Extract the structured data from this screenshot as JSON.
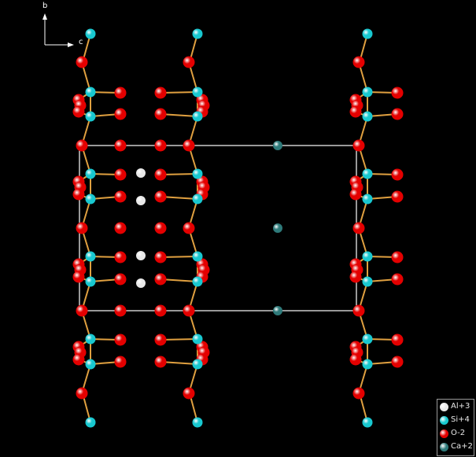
{
  "axes": {
    "b_label": "b",
    "c_label": "c"
  },
  "colors": {
    "background": "#000000",
    "bond": "#e0a040",
    "cell": "#ffffff",
    "Al": "#e8e8e8",
    "Si": "#18c8d0",
    "O": "#e40000",
    "Ca": "#2e7a7a"
  },
  "legend": [
    {
      "symbol": "Al",
      "label": "Al+3"
    },
    {
      "symbol": "Si",
      "label": "Si+4"
    },
    {
      "symbol": "O",
      "label": "O-2"
    },
    {
      "symbol": "Ca",
      "label": "Ca+2"
    }
  ]
}
